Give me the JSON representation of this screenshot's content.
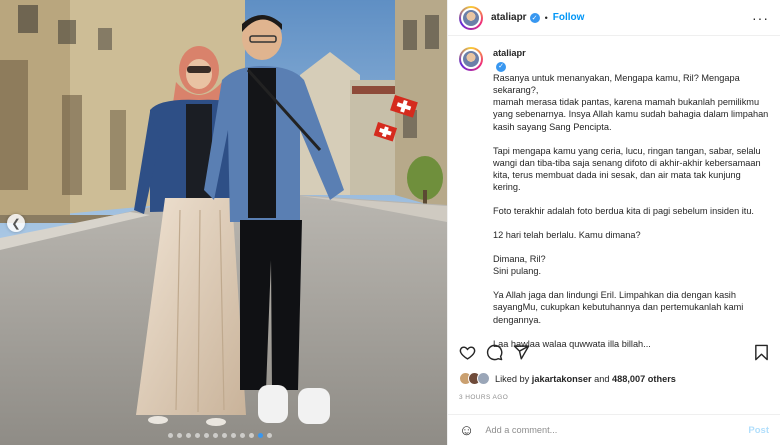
{
  "post": {
    "username": "ataliapr",
    "follow_label": "Follow",
    "separator": "•",
    "more_icon": "more-horizontal-icon",
    "verified_icon": "verified-badge-icon"
  },
  "caption": {
    "username": "ataliapr",
    "paragraphs": [
      "Rasanya untuk menanyakan, Mengapa kamu, Ril? Mengapa sekarang?,\nmamah merasa tidak pantas, karena mamah bukanlah pemilikmu yang sebenarnya. Insya Allah kamu sudah bahagia dalam limpahan kasih sayang Sang Pencipta.",
      "Tapi mengapa kamu yang ceria, lucu, ringan tangan, sabar, selalu wangi dan tiba-tiba saja senang difoto di akhir-akhir kebersamaan kita, terus membuat dada ini sesak, dan air mata tak kunjung kering.",
      "Foto terakhir adalah foto berdua kita di pagi sebelum insiden itu.",
      "12 hari telah berlalu. Kamu dimana?",
      "Dimana, Ril?\nSini pulang.",
      "Ya Allah jaga dan lindungi Eril. Limpahkan dia dengan kasih sayangMu, cukupkan kebutuhannya dan pertemukanlah kami dengannya.",
      "Laa hawlaa walaa quwwata illa billah..."
    ]
  },
  "likes": {
    "prefix": "Liked by",
    "user": "jakartakonser",
    "conjunction": "and",
    "count": "488,007 others"
  },
  "timestamp": "3 HOURS AGO",
  "comment": {
    "placeholder": "Add a comment...",
    "post_label": "Post",
    "emoji_icon": "emoji-smile-icon"
  },
  "carousel": {
    "total_slides": 12,
    "active_index": 10
  },
  "colors": {
    "accent": "#0095f6",
    "post_disabled": "#b2dffc",
    "muted": "#8e8e8e",
    "text": "#262626",
    "dot_active": "#3897f0"
  },
  "icons": [
    "heart-icon",
    "comment-icon",
    "share-icon",
    "bookmark-icon",
    "chevron-left-icon"
  ]
}
